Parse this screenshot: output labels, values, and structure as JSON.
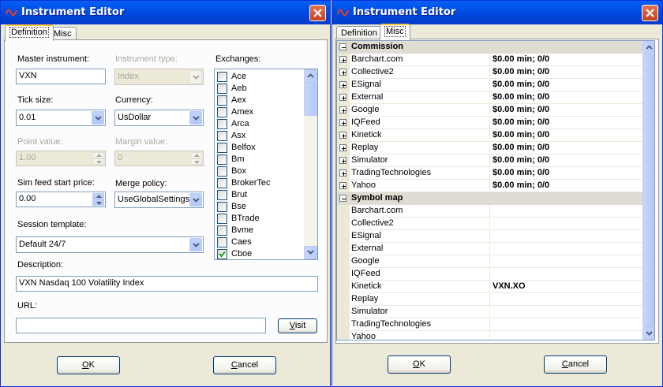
{
  "window_left": {
    "title": "Instrument Editor",
    "tabs": [
      {
        "label": "Definition",
        "active": true
      },
      {
        "label": "Misc",
        "active": false
      }
    ],
    "master_instrument": {
      "label": "Master instrument:",
      "value": "VXN"
    },
    "instrument_type": {
      "label": "Instrument type:",
      "value": "Index"
    },
    "exchanges": {
      "label": "Exchanges:",
      "items": [
        {
          "name": "Ace",
          "checked": false
        },
        {
          "name": "Aeb",
          "checked": false
        },
        {
          "name": "Aex",
          "checked": false
        },
        {
          "name": "Amex",
          "checked": false
        },
        {
          "name": "Arca",
          "checked": false
        },
        {
          "name": "Asx",
          "checked": false
        },
        {
          "name": "Belfox",
          "checked": false
        },
        {
          "name": "Bm",
          "checked": false
        },
        {
          "name": "Box",
          "checked": false
        },
        {
          "name": "BrokerTec",
          "checked": false
        },
        {
          "name": "Brut",
          "checked": false
        },
        {
          "name": "Bse",
          "checked": false
        },
        {
          "name": "BTrade",
          "checked": false
        },
        {
          "name": "Bvme",
          "checked": false
        },
        {
          "name": "Caes",
          "checked": false
        },
        {
          "name": "Cboe",
          "checked": true
        }
      ]
    },
    "tick_size": {
      "label": "Tick size:",
      "value": "0.01"
    },
    "currency": {
      "label": "Currency:",
      "value": "UsDollar"
    },
    "point_value": {
      "label": "Point value:",
      "value": "1.00"
    },
    "margin_value": {
      "label": "Margin value:",
      "value": "0"
    },
    "sim_feed_start_price": {
      "label": "Sim feed start price:",
      "value": "0.00"
    },
    "merge_policy": {
      "label": "Merge policy:",
      "value": "UseGlobalSettings"
    },
    "session_template": {
      "label": "Session template:",
      "value": "Default 24/7"
    },
    "description": {
      "label": "Description:",
      "value": "VXN Nasdaq 100 Volatility Index"
    },
    "url": {
      "label": "URL:",
      "value": ""
    },
    "visit_button": {
      "underlined": "V",
      "rest": "isit"
    },
    "ok_button": {
      "underlined": "O",
      "rest": "K"
    },
    "cancel_button": {
      "underlined": "C",
      "rest": "ancel"
    }
  },
  "window_right": {
    "title": "Instrument Editor",
    "tabs": [
      {
        "label": "Definition",
        "active": false
      },
      {
        "label": "Misc",
        "active": true
      }
    ],
    "commission": {
      "label": "Commission",
      "rows": [
        {
          "name": "Barchart.com",
          "value": "$0.00 min;  0/0"
        },
        {
          "name": "Collective2",
          "value": "$0.00 min;  0/0"
        },
        {
          "name": "ESignal",
          "value": "$0.00 min;  0/0"
        },
        {
          "name": "External",
          "value": "$0.00 min;  0/0"
        },
        {
          "name": "Google",
          "value": "$0.00 min;  0/0"
        },
        {
          "name": "IQFeed",
          "value": "$0.00 min;  0/0"
        },
        {
          "name": "Kinetick",
          "value": "$0.00 min;  0/0"
        },
        {
          "name": "Replay",
          "value": "$0.00 min;  0/0"
        },
        {
          "name": "Simulator",
          "value": "$0.00 min;  0/0"
        },
        {
          "name": "TradingTechnologies",
          "value": "$0.00 min;  0/0"
        },
        {
          "name": "Yahoo",
          "value": "$0.00 min;  0/0"
        }
      ]
    },
    "symbol_map": {
      "label": "Symbol map",
      "rows": [
        {
          "name": "Barchart.com",
          "value": ""
        },
        {
          "name": "Collective2",
          "value": ""
        },
        {
          "name": "ESignal",
          "value": ""
        },
        {
          "name": "External",
          "value": ""
        },
        {
          "name": "Google",
          "value": ""
        },
        {
          "name": "IQFeed",
          "value": ""
        },
        {
          "name": "Kinetick",
          "value": "VXN.XO"
        },
        {
          "name": "Replay",
          "value": ""
        },
        {
          "name": "Simulator",
          "value": ""
        },
        {
          "name": "TradingTechnologies",
          "value": ""
        },
        {
          "name": "Yahoo",
          "value": ""
        }
      ]
    },
    "ok_button": {
      "underlined": "O",
      "rest": "K"
    },
    "cancel_button": {
      "underlined": "C",
      "rest": "ancel"
    }
  },
  "colors": {
    "title_bar": "#0054E3",
    "dialog_bg": "#ECE9D8",
    "close_red": "#D8532F",
    "tab_accent": "#FFC83C"
  },
  "icons": [
    "app-wave-icon",
    "close-icon",
    "chevron-down-icon",
    "spin-up-icon",
    "spin-down-icon",
    "checkmark-icon",
    "expand-plus-icon",
    "collapse-minus-icon",
    "scroll-up-icon",
    "scroll-down-icon"
  ]
}
